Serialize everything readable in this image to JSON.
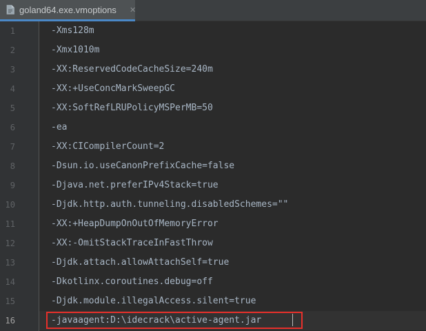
{
  "tab": {
    "title": "goland64.exe.vmoptions",
    "icon": "vmoptions-file-icon",
    "close_glyph": "✕"
  },
  "editor": {
    "current_line": 16,
    "lines": [
      {
        "num": "1",
        "text": "-Xms128m"
      },
      {
        "num": "2",
        "text": "-Xmx1010m"
      },
      {
        "num": "3",
        "text": "-XX:ReservedCodeCacheSize=240m"
      },
      {
        "num": "4",
        "text": "-XX:+UseConcMarkSweepGC"
      },
      {
        "num": "5",
        "text": "-XX:SoftRefLRUPolicyMSPerMB=50"
      },
      {
        "num": "6",
        "text": "-ea"
      },
      {
        "num": "7",
        "text": "-XX:CICompilerCount=2"
      },
      {
        "num": "8",
        "text": "-Dsun.io.useCanonPrefixCache=false"
      },
      {
        "num": "9",
        "text": "-Djava.net.preferIPv4Stack=true"
      },
      {
        "num": "10",
        "text": "-Djdk.http.auth.tunneling.disabledSchemes=\"\""
      },
      {
        "num": "11",
        "text": "-XX:+HeapDumpOnOutOfMemoryError"
      },
      {
        "num": "12",
        "text": "-XX:-OmitStackTraceInFastThrow"
      },
      {
        "num": "13",
        "text": "-Djdk.attach.allowAttachSelf=true"
      },
      {
        "num": "14",
        "text": "-Dkotlinx.coroutines.debug=off"
      },
      {
        "num": "15",
        "text": "-Djdk.module.illegalAccess.silent=true"
      },
      {
        "num": "16",
        "text": "-javaagent:D:\\idecrack\\active-agent.jar"
      }
    ]
  },
  "colors": {
    "background": "#2b2b2b",
    "gutter": "#313335",
    "text": "#a9b7c6",
    "line_number": "#606366",
    "highlight_border": "#e8302b",
    "tab_underline": "#4a88c7"
  }
}
